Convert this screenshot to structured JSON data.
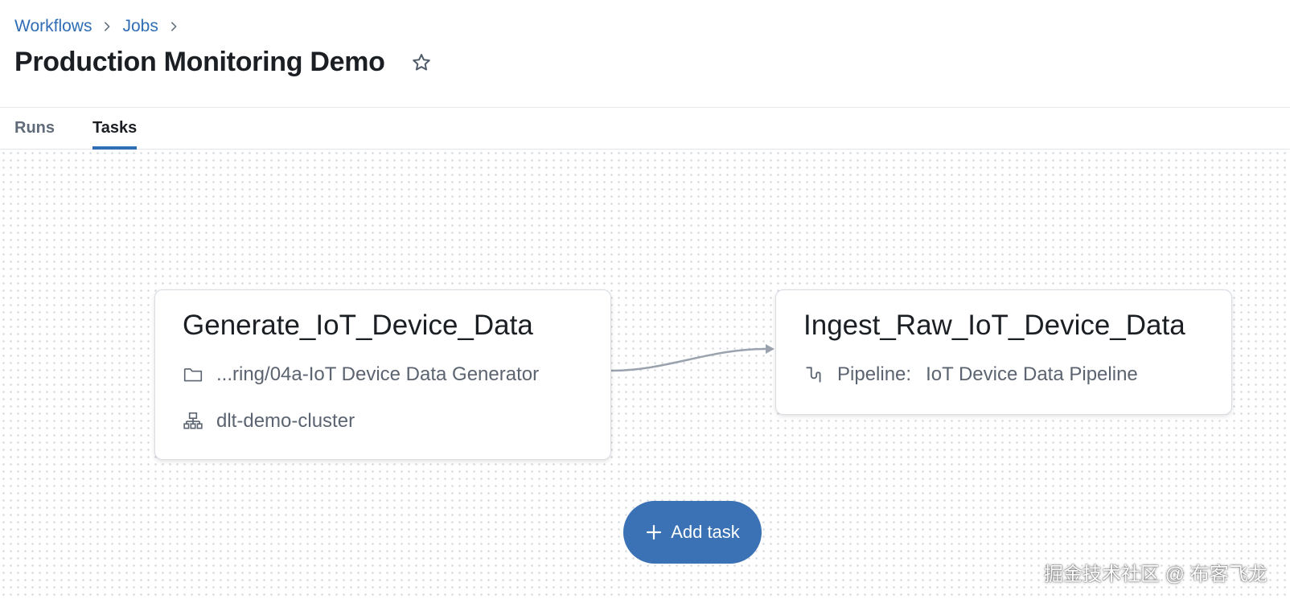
{
  "breadcrumb": {
    "items": [
      "Workflows",
      "Jobs"
    ]
  },
  "page": {
    "title": "Production Monitoring Demo"
  },
  "tabs": [
    {
      "label": "Runs",
      "active": false
    },
    {
      "label": "Tasks",
      "active": true
    }
  ],
  "tasks": [
    {
      "name": "Generate_IoT_Device_Data",
      "notebook_path": "...ring/04a-IoT Device Data Generator",
      "cluster": "dlt-demo-cluster"
    },
    {
      "name": "Ingest_Raw_IoT_Device_Data",
      "pipeline_label": "Pipeline:",
      "pipeline_name": "IoT Device Data Pipeline"
    }
  ],
  "actions": {
    "add_task_label": "Add task"
  },
  "watermark": "掘金技术社区 @ 布客飞龙",
  "colors": {
    "accent": "#2f6db5",
    "button": "#3b72b5"
  },
  "icons": [
    "chevron-right-icon",
    "star-icon",
    "folder-icon",
    "cluster-icon",
    "pipeline-icon",
    "plus-icon"
  ]
}
